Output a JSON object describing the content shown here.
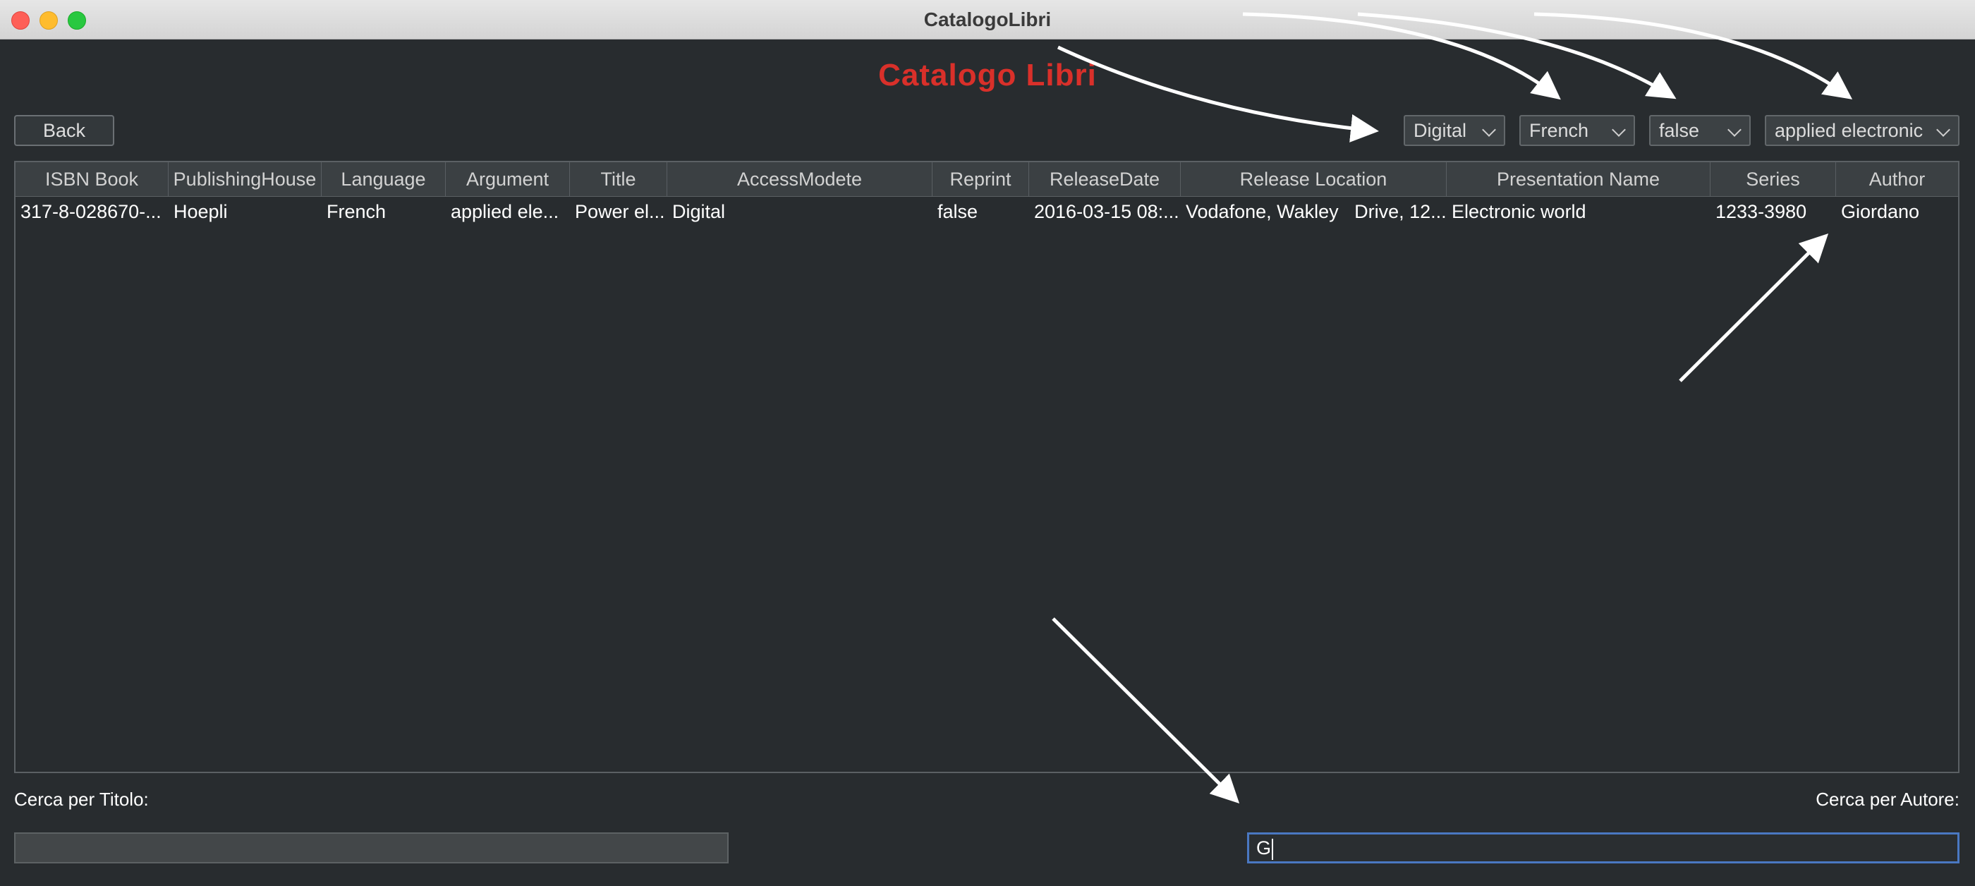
{
  "window": {
    "title": "CatalogoLibri"
  },
  "heading": "Catalogo Libri",
  "toolbar": {
    "back_label": "Back"
  },
  "filters": [
    {
      "name": "filter-access-mode",
      "value": "Digital"
    },
    {
      "name": "filter-language",
      "value": "French"
    },
    {
      "name": "filter-reprint",
      "value": "false"
    },
    {
      "name": "filter-argument",
      "value": "applied electronic"
    }
  ],
  "table": {
    "columns": [
      "ISBN Book",
      "PublishingHouse",
      "Language",
      "Argument",
      "Title",
      "AccessModete",
      "Reprint",
      "ReleaseDate",
      "Release Location",
      "Presentation Name",
      "Series",
      "Author"
    ],
    "rows": [
      [
        "317-8-028670-...",
        "Hoepli",
        "French",
        "applied ele...",
        "Power el...",
        "Digital",
        "false",
        "2016-03-15 08:...",
        "Vodafone, Wakley   Drive, 12...",
        "Electronic world",
        "1233-3980",
        "Giordano"
      ]
    ]
  },
  "search": {
    "title_label": "Cerca per Titolo:",
    "title_value": "",
    "author_label": "Cerca per Autore:",
    "author_value": "G"
  },
  "colors": {
    "heading": "#d9302a",
    "background": "#282c2f",
    "focus": "#4a78c2"
  },
  "icons": [
    "close-window-icon",
    "minimize-window-icon",
    "maximize-window-icon",
    "chevron-down-icon"
  ]
}
